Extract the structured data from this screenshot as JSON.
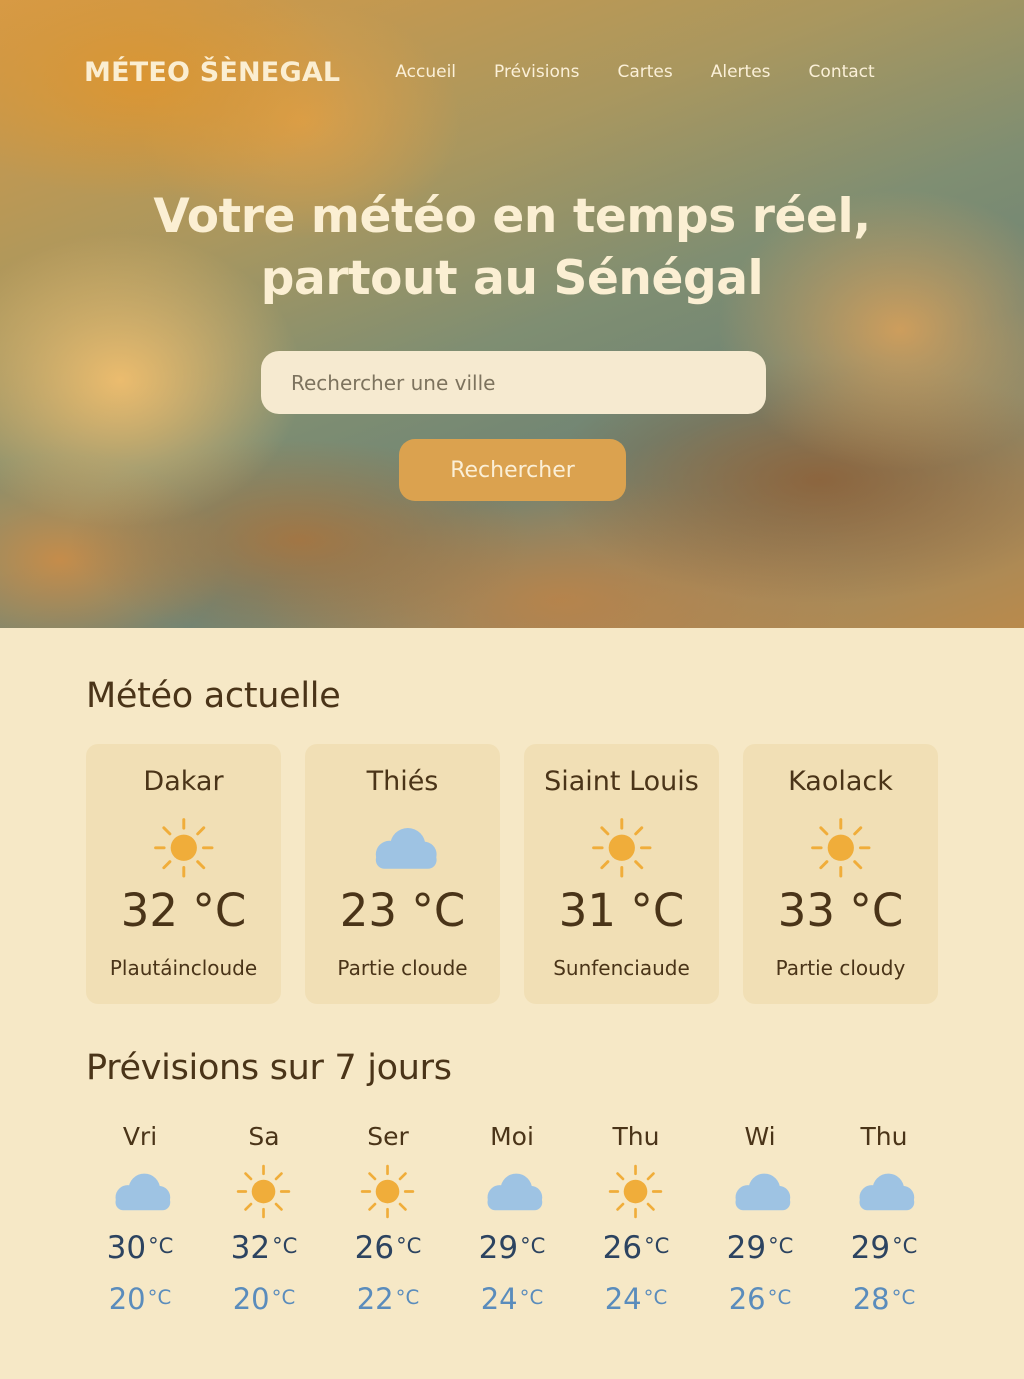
{
  "header": {
    "brand": "MÉTEO ŠÈNEGAL",
    "nav": [
      "Accueil",
      "Prévisions",
      "Cartes",
      "Alertes",
      "Contact"
    ]
  },
  "hero": {
    "title_line1": "Votre météo en temps réel,",
    "title_line2": "partout au Sénégal",
    "search_placeholder": "Rechercher une ville",
    "search_button": "Rechercher"
  },
  "current": {
    "title": "Météo actuelle",
    "cities": [
      {
        "name": "Dakar",
        "icon": "sun-icon",
        "temp": "32 °C",
        "desc": "Plautáincloude"
      },
      {
        "name": "Thiés",
        "icon": "cloud-icon",
        "temp": "23 °C",
        "desc": "Partie cloude"
      },
      {
        "name": "Siaint Louis",
        "icon": "sun-icon",
        "temp": "31 °C",
        "desc": "Sunfenciaude"
      },
      {
        "name": "Kaolack",
        "icon": "sun-icon",
        "temp": "33 °C",
        "desc": "Partie cloudy"
      }
    ]
  },
  "forecast": {
    "title": "Prévisions sur 7 jours",
    "unit": "°C",
    "days": [
      {
        "day": "Vri",
        "icon": "cloud-icon",
        "high": "30",
        "low": "20"
      },
      {
        "day": "Sa",
        "icon": "sun-icon",
        "high": "32",
        "low": "20"
      },
      {
        "day": "Ser",
        "icon": "sun-icon",
        "high": "26",
        "low": "22"
      },
      {
        "day": "Moi",
        "icon": "cloud-icon",
        "high": "29",
        "low": "24"
      },
      {
        "day": "Thu",
        "icon": "sun-icon",
        "high": "26",
        "low": "24"
      },
      {
        "day": "Wi",
        "icon": "cloud-icon",
        "high": "29",
        "low": "26"
      },
      {
        "day": "Thu",
        "icon": "cloud-icon",
        "high": "29",
        "low": "28"
      }
    ]
  },
  "colors": {
    "sun": "#f0ad3a",
    "cloud": "#9ec3e3",
    "accent": "#dba24f",
    "background": "#f6e8c6",
    "card": "#f1dfb5",
    "high_temp": "#2c4360",
    "low_temp": "#5a8cbc"
  }
}
